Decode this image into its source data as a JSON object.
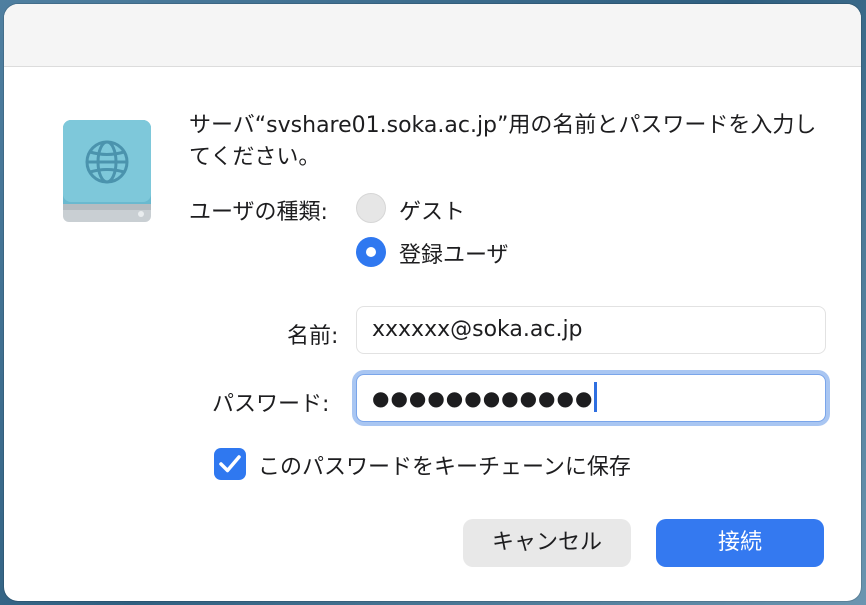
{
  "dialog": {
    "prompt": "サーバ“svshare01.soka.ac.jp”用の名前とパスワードを入力してください。",
    "user_type_label": "ユーザの種類:",
    "user_type_options": [
      {
        "label": "ゲスト",
        "selected": false
      },
      {
        "label": "登録ユーザ",
        "selected": true
      }
    ],
    "name_label": "名前:",
    "name_value": "xxxxxx@soka.ac.jp",
    "password_label": "パスワード:",
    "password_value": "●●●●●●●●●●●●",
    "keychain_label": "このパスワードをキーチェーンに保存",
    "keychain_checked": true,
    "cancel_label": "キャンセル",
    "connect_label": "接続"
  },
  "icons": {
    "drive": "network-drive-icon",
    "globe": "globe-icon",
    "check": "checkmark-icon"
  },
  "colors": {
    "accent": "#3479f0",
    "drive_top": "#7cc6d9",
    "drive_body": "#5eaec5"
  }
}
